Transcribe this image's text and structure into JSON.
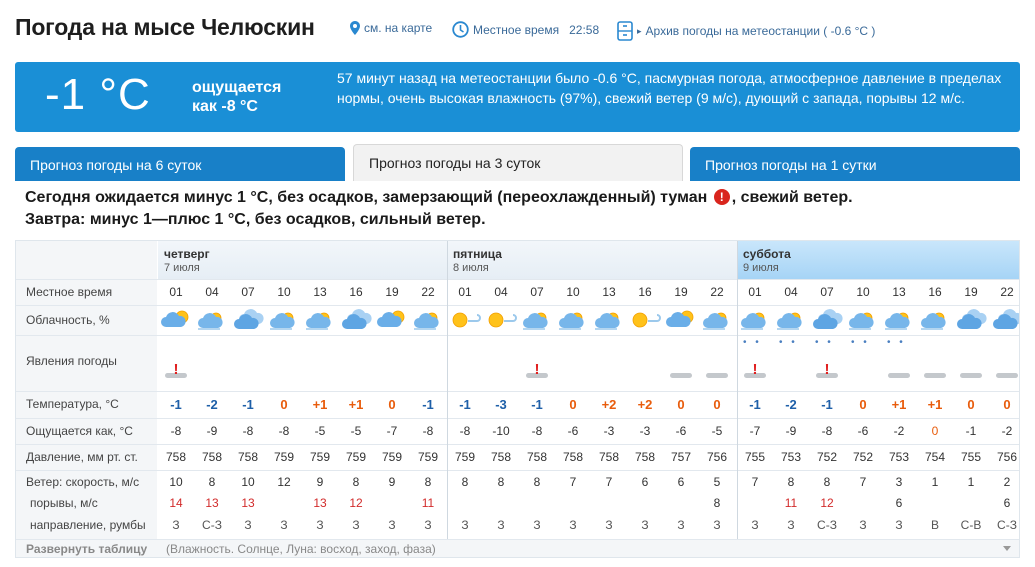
{
  "header": {
    "title": "Погода на мысе Челюскин",
    "map_link": "см. на карте",
    "local_time_label": "Местное время",
    "local_time_value": "22:58",
    "archive_link": "Архив погоды на метеостанции ( -0.6 °C )"
  },
  "current": {
    "temp": "-1 °C",
    "feels_line1": "ощущается",
    "feels_line2": "как -8 °C",
    "description": "57 минут назад на метеостанции было -0.6 °C, пасмурная погода, атмосферное давление в пределах нормы, очень высокая влажность (97%), свежий ветер (9 м/с), дующий с запада, порывы 12 м/с."
  },
  "tabs": [
    {
      "label": "Прогноз погоды на 6 суток",
      "active": false
    },
    {
      "label": "Прогноз погоды на 3 суток",
      "active": true
    },
    {
      "label": "Прогноз погоды на 1 сутки",
      "active": false
    }
  ],
  "summary": {
    "today_before": "Сегодня ожидается минус 1 °C, без осадков, замерзающий (переохлажденный) туман",
    "today_after": ", свежий ветер.",
    "tomorrow": "Завтра: минус 1—плюс 1 °C, без осадков, сильный ветер."
  },
  "table": {
    "row_labels": {
      "time": "Местное время",
      "cloud": "Облачность, %",
      "phen": "Явления погоды",
      "temp": "Температура, °C",
      "feels": "Ощущается как, °C",
      "pressure": "Давление, мм рт. ст.",
      "wind": "Ветер: скорость, м/с",
      "gusts": "порывы, м/с",
      "dir": "направление, румбы"
    },
    "days": [
      {
        "name": "четверг",
        "date": "7 июля"
      },
      {
        "name": "пятница",
        "date": "8 июля"
      },
      {
        "name": "суббота",
        "date": "9 июля"
      }
    ],
    "hours": [
      "01",
      "04",
      "07",
      "10",
      "13",
      "16",
      "19",
      "22",
      "01",
      "04",
      "07",
      "10",
      "13",
      "16",
      "19",
      "22",
      "01",
      "04",
      "07",
      "10",
      "13",
      "16",
      "19",
      "22"
    ],
    "cloud_icons": [
      "cloudy-sun-icon",
      "partly-cloudy-icon",
      "overcast-icon",
      "partly-cloudy-icon",
      "partly-cloudy-icon",
      "overcast-icon",
      "cloudy-sun-icon",
      "partly-cloudy-icon",
      "sun-icon",
      "sun-icon",
      "partly-cloudy-icon",
      "partly-cloudy-icon",
      "partly-cloudy-icon",
      "sun-icon",
      "cloudy-sun-icon",
      "partly-cloudy-icon",
      "partly-cloudy-icon",
      "partly-cloudy-icon",
      "overcast-icon",
      "partly-cloudy-icon",
      "partly-cloudy-icon",
      "partly-cloudy-icon",
      "overcast-icon",
      "overcast-icon"
    ],
    "phenomena": [
      "fog-warning",
      "",
      "",
      "",
      "",
      "",
      "",
      "",
      "",
      "",
      "fog-warning",
      "",
      "",
      "",
      "fog",
      "fog",
      "fog-warning-snow",
      "snow",
      "fog-warning-snow",
      "snow",
      "fog-snow",
      "fog",
      "fog",
      "fog"
    ],
    "temperature": [
      "-1",
      "-2",
      "-1",
      "0",
      "+1",
      "+1",
      "0",
      "-1",
      "-1",
      "-3",
      "-1",
      "0",
      "+2",
      "+2",
      "0",
      "0",
      "-1",
      "-2",
      "-1",
      "0",
      "+1",
      "+1",
      "0",
      "0"
    ],
    "feels_like": [
      "-8",
      "-9",
      "-8",
      "-8",
      "-5",
      "-5",
      "-7",
      "-8",
      "-8",
      "-10",
      "-8",
      "-6",
      "-3",
      "-3",
      "-6",
      "-5",
      "-7",
      "-9",
      "-8",
      "-6",
      "-2",
      "0",
      "-1",
      "-2"
    ],
    "pressure": [
      "758",
      "758",
      "758",
      "759",
      "759",
      "759",
      "759",
      "759",
      "759",
      "758",
      "758",
      "758",
      "758",
      "758",
      "757",
      "756",
      "755",
      "753",
      "752",
      "752",
      "753",
      "754",
      "755",
      "756"
    ],
    "wind_speed": [
      "10",
      "8",
      "10",
      "12",
      "9",
      "8",
      "9",
      "8",
      "8",
      "8",
      "8",
      "7",
      "7",
      "6",
      "6",
      "5",
      "7",
      "8",
      "8",
      "7",
      "3",
      "1",
      "1",
      "2"
    ],
    "gusts": [
      "14",
      "13",
      "13",
      "",
      "13",
      "12",
      "",
      "11",
      "",
      "",
      "",
      "",
      "",
      "",
      "",
      "8",
      "",
      "11",
      "12",
      "",
      "6",
      "",
      "",
      "6"
    ],
    "direction": [
      "З",
      "С-З",
      "З",
      "З",
      "З",
      "З",
      "З",
      "З",
      "З",
      "З",
      "З",
      "З",
      "З",
      "З",
      "З",
      "З",
      "З",
      "З",
      "С-З",
      "З",
      "З",
      "В",
      "С-В",
      "С-З"
    ],
    "expand_label": "Развернуть таблицу",
    "expand_hint": "(Влажность. Солнце, Луна: восход, заход, фаза)"
  },
  "colors": {
    "accent_blue": "#1a8fd6",
    "tab_blue": "#1880c8",
    "negative_temp": "#1e5fa8",
    "positive_temp": "#e85c0c",
    "gust_red": "#d22b2b"
  }
}
